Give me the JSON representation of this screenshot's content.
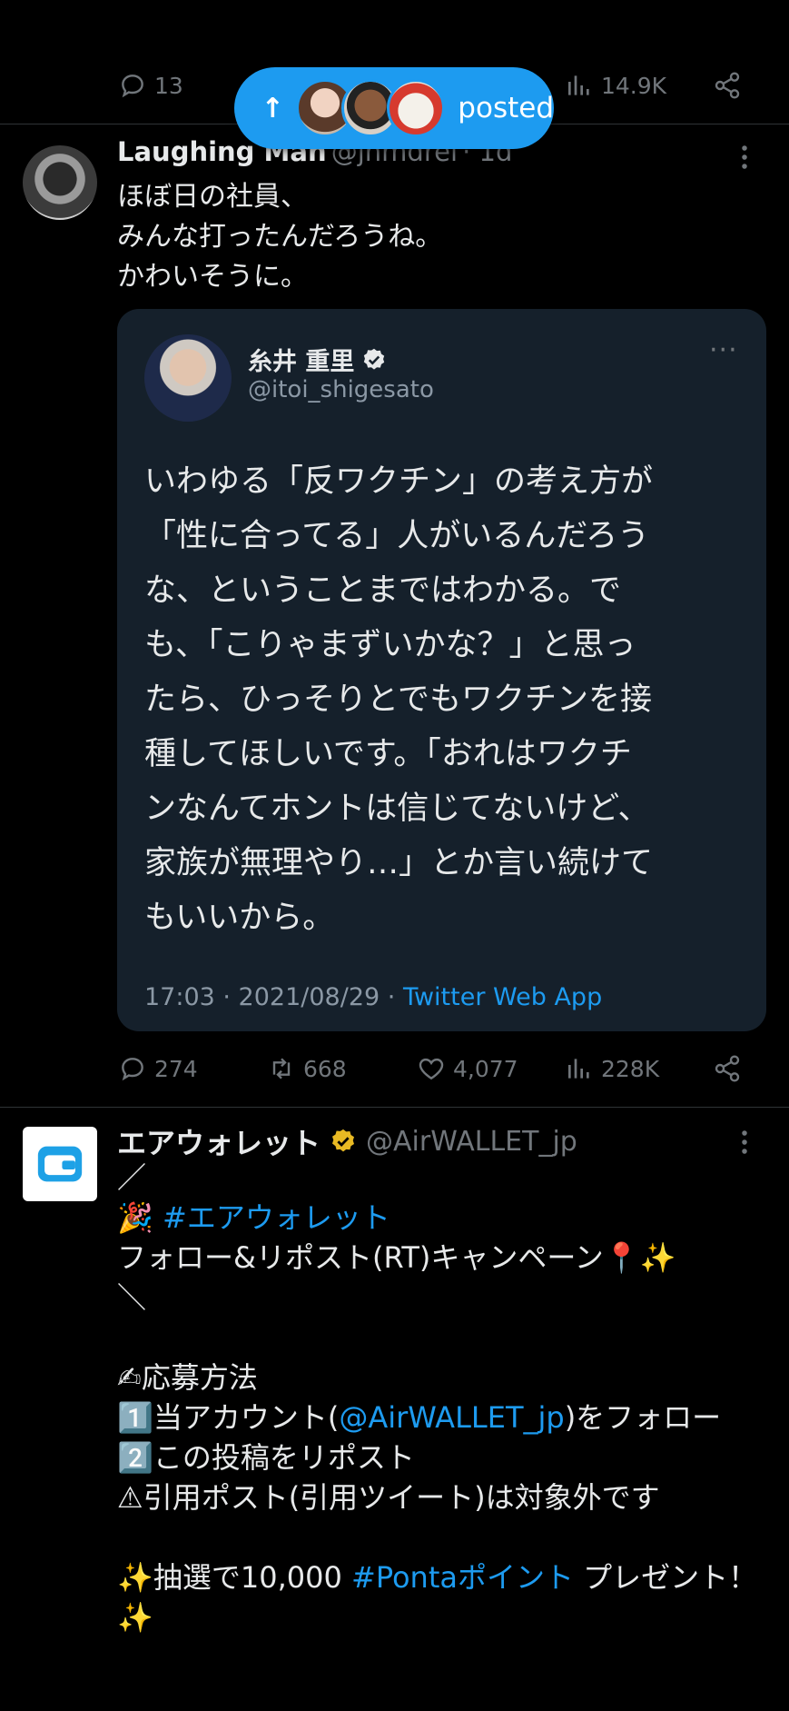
{
  "top_post": {
    "reply_count": "13",
    "views": "14.9K"
  },
  "new_posts_pill": {
    "label": "posted"
  },
  "tweet1": {
    "name": "Laughing Man",
    "handle": "@jnmdrei",
    "time": "· 1d",
    "text": "ほぼ日の社員、\nみんな打ったんだろうね。\nかわいそうに。",
    "quote": {
      "name": "糸井 重里",
      "handle": "@itoi_shigesato",
      "lines": [
        "いわゆる「反ワクチン」の考え方が",
        "「性に合ってる」人がいるんだろう",
        "な、ということまではわかる。で",
        "も、「こりゃまずいかな？」と思っ",
        "たら、ひっそりとでもワクチンを接",
        "種してほしいです。「おれはワクチ",
        "ンなんてホントは信じてないけど、",
        "家族が無理やり…」とか言い続けて",
        "もいいから。"
      ],
      "timestamp": "17:03 · 2021/08/29 · ",
      "source": "Twitter Web App"
    },
    "replies": "274",
    "reposts": "668",
    "likes": "4,077",
    "views": "228K"
  },
  "tweet2": {
    "name": "エアウォレット",
    "handle": "@AirWALLET_jp",
    "line1": "／",
    "hashtag1": "#エアウォレット",
    "line3": "フォロー&リポスト(RT)キャンペーン",
    "line4": "＼",
    "line6": "✍応募方法",
    "line7a": "1️⃣当アカウント(",
    "line7_mention": "@AirWALLET_jp",
    "line7b": ")をフォロー",
    "line8": "2️⃣この投稿をリポスト",
    "line9": "⚠引用ポスト(引用ツイート)は対象外です",
    "line11a": "抽選で10,000 ",
    "line11_hashtag": "#Pontaポイント",
    "line11b": " プレゼント！"
  },
  "colors": {
    "accent": "#1d9bf0",
    "muted": "#71767b",
    "quote_bg": "#15202b",
    "gold_badge": "#e8b923"
  },
  "icons": [
    "reply-icon",
    "repost-icon",
    "like-icon",
    "views-icon",
    "share-icon",
    "verified-icon",
    "more-icon",
    "arrow-up-icon",
    "wallet-icon"
  ]
}
